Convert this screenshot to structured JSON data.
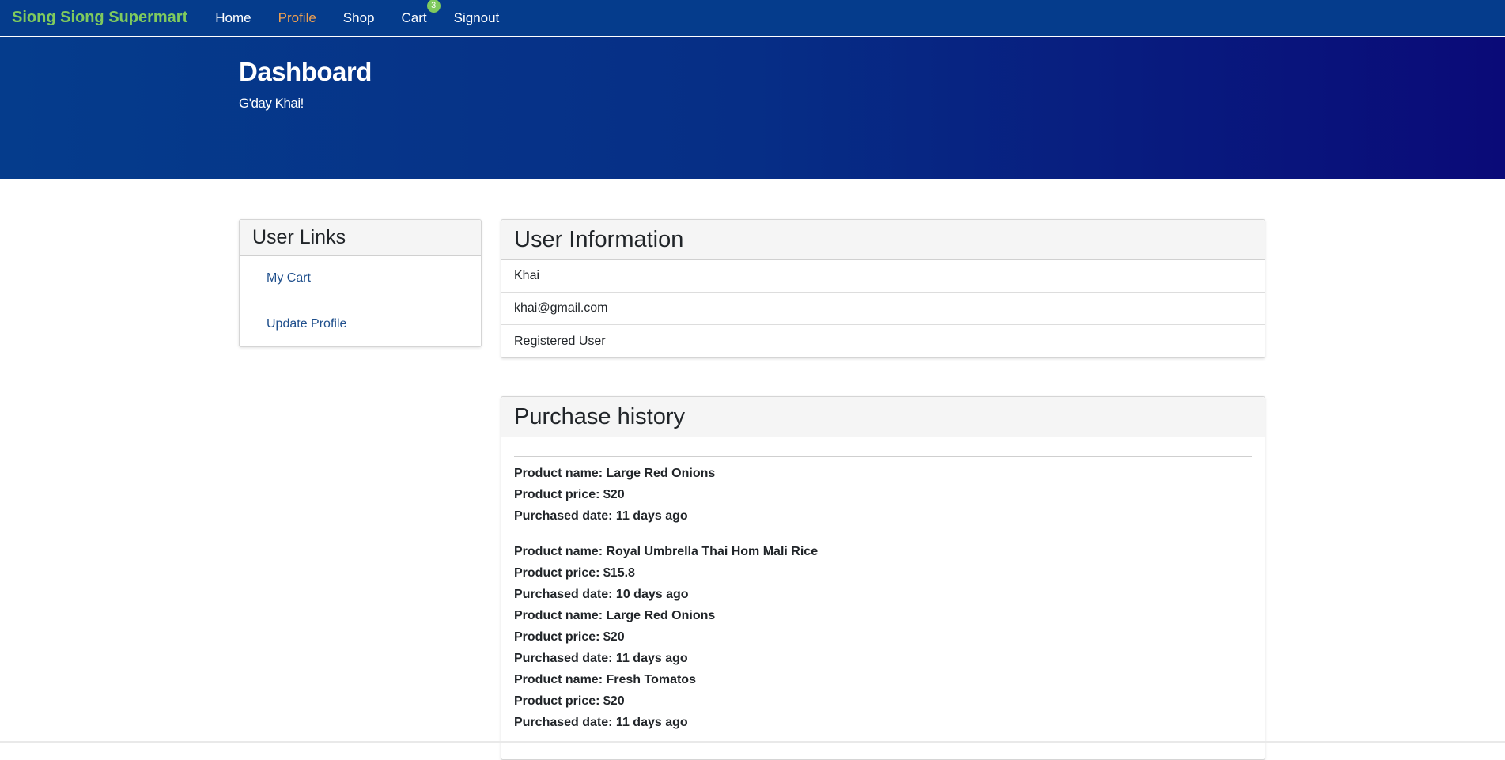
{
  "navbar": {
    "brand": "Siong Siong Supermart",
    "links": [
      {
        "label": "Home"
      },
      {
        "label": "Profile"
      },
      {
        "label": "Shop"
      },
      {
        "label": "Cart"
      },
      {
        "label": "Signout"
      }
    ],
    "cart_count": "3",
    "active": "Profile"
  },
  "hero": {
    "title": "Dashboard",
    "subtitle": "G'day Khai!"
  },
  "user_links": {
    "title": "User Links",
    "items": [
      {
        "label": "My Cart"
      },
      {
        "label": "Update Profile"
      }
    ]
  },
  "user_info": {
    "title": "User Information",
    "rows": [
      {
        "value": "Khai"
      },
      {
        "value": "khai@gmail.com"
      },
      {
        "value": "Registered User"
      }
    ]
  },
  "purchase_history": {
    "title": "Purchase history",
    "groups": [
      {
        "lines": [
          "Product name: Large Red Onions",
          "Product price: $20",
          "Purchased date: 11 days ago"
        ]
      },
      {
        "lines": [
          "Product name: Royal Umbrella Thai Hom Mali Rice",
          "Product price: $15.8",
          "Purchased date: 10 days ago",
          "Product name: Large Red Onions",
          "Product price: $20",
          "Purchased date: 11 days ago",
          "Product name: Fresh Tomatos",
          "Product price: $20",
          "Purchased date: 11 days ago"
        ]
      }
    ]
  },
  "colors": {
    "navbar_bg": "#053c8c",
    "brand": "#7fca5e",
    "active_link": "#f0a050",
    "hero_gradient_end": "#0a0a78",
    "link": "#1f4f8c"
  }
}
